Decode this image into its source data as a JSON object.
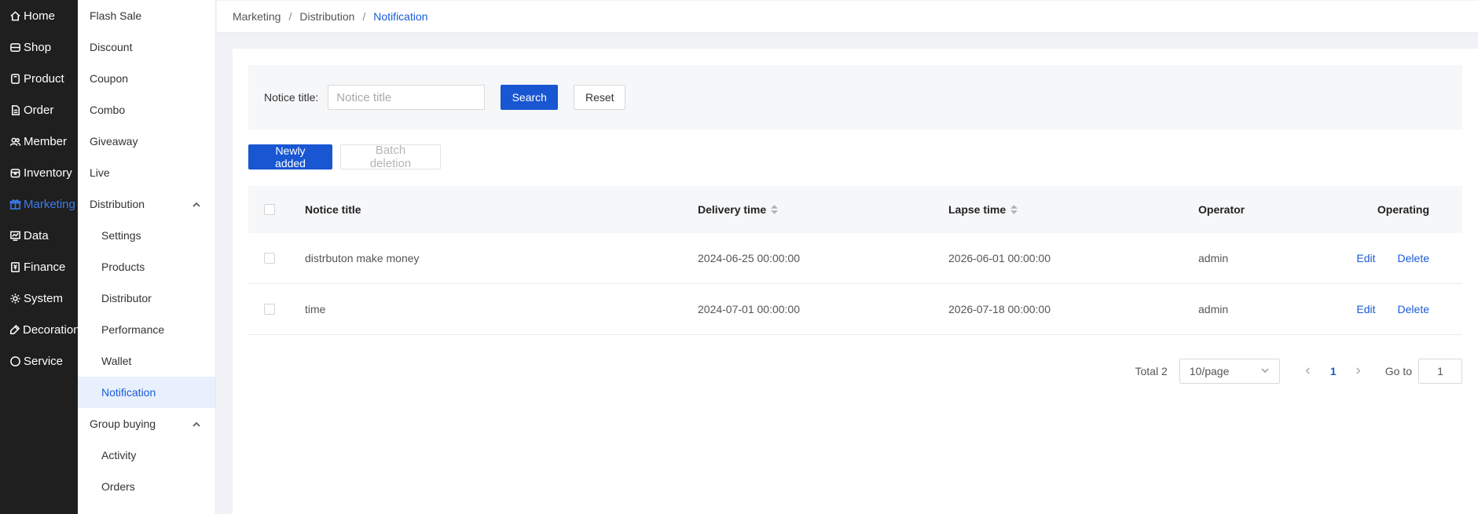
{
  "nav_primary": [
    {
      "label": "Home",
      "icon": "home-icon"
    },
    {
      "label": "Shop",
      "icon": "shop-icon"
    },
    {
      "label": "Product",
      "icon": "product-icon"
    },
    {
      "label": "Order",
      "icon": "order-icon"
    },
    {
      "label": "Member",
      "icon": "member-icon"
    },
    {
      "label": "Inventory",
      "icon": "inventory-icon"
    },
    {
      "label": "Marketing",
      "icon": "gift-icon",
      "active": true
    },
    {
      "label": "Data",
      "icon": "data-icon"
    },
    {
      "label": "Finance",
      "icon": "finance-icon"
    },
    {
      "label": "System",
      "icon": "gear-icon"
    },
    {
      "label": "Decoration",
      "icon": "brush-icon"
    },
    {
      "label": "Service",
      "icon": "chat-icon"
    }
  ],
  "nav_secondary": [
    {
      "label": "Flash Sale"
    },
    {
      "label": "Discount"
    },
    {
      "label": "Coupon"
    },
    {
      "label": "Combo"
    },
    {
      "label": "Giveaway"
    },
    {
      "label": "Live"
    },
    {
      "label": "Distribution",
      "expanded": true
    },
    {
      "label": "Settings",
      "sub": true
    },
    {
      "label": "Products",
      "sub": true
    },
    {
      "label": "Distributor",
      "sub": true
    },
    {
      "label": "Performance",
      "sub": true
    },
    {
      "label": "Wallet",
      "sub": true
    },
    {
      "label": "Notification",
      "sub": true,
      "active": true
    },
    {
      "label": "Group buying",
      "expanded": true
    },
    {
      "label": "Activity",
      "sub": true
    },
    {
      "label": "Orders",
      "sub": true
    }
  ],
  "breadcrumb": {
    "items": [
      "Marketing",
      "Distribution",
      "Notification"
    ],
    "separator": "/"
  },
  "filter": {
    "label": "Notice title:",
    "placeholder": "Notice title",
    "value": "",
    "search_label": "Search",
    "reset_label": "Reset"
  },
  "toolbar": {
    "add_label": "Newly added",
    "batch_delete_label": "Batch deletion"
  },
  "table": {
    "headers": {
      "title": "Notice title",
      "delivery": "Delivery time",
      "lapse": "Lapse time",
      "operator": "Operator",
      "operating": "Operating"
    },
    "rows": [
      {
        "title": "distrbuton make money",
        "delivery": "2024-06-25 00:00:00",
        "lapse": "2026-06-01 00:00:00",
        "operator": "admin",
        "edit": "Edit",
        "delete": "Delete"
      },
      {
        "title": "time",
        "delivery": "2024-07-01 00:00:00",
        "lapse": "2026-07-18 00:00:00",
        "operator": "admin",
        "edit": "Edit",
        "delete": "Delete"
      }
    ]
  },
  "pagination": {
    "total": "Total 2",
    "page_size": "10/page",
    "current_page": "1",
    "goto_label": "Go to",
    "goto_value": "1"
  },
  "colors": {
    "accent": "#1856d2",
    "sidebar_bg": "#1f1f1f",
    "active_bg": "#e8f0fd"
  }
}
